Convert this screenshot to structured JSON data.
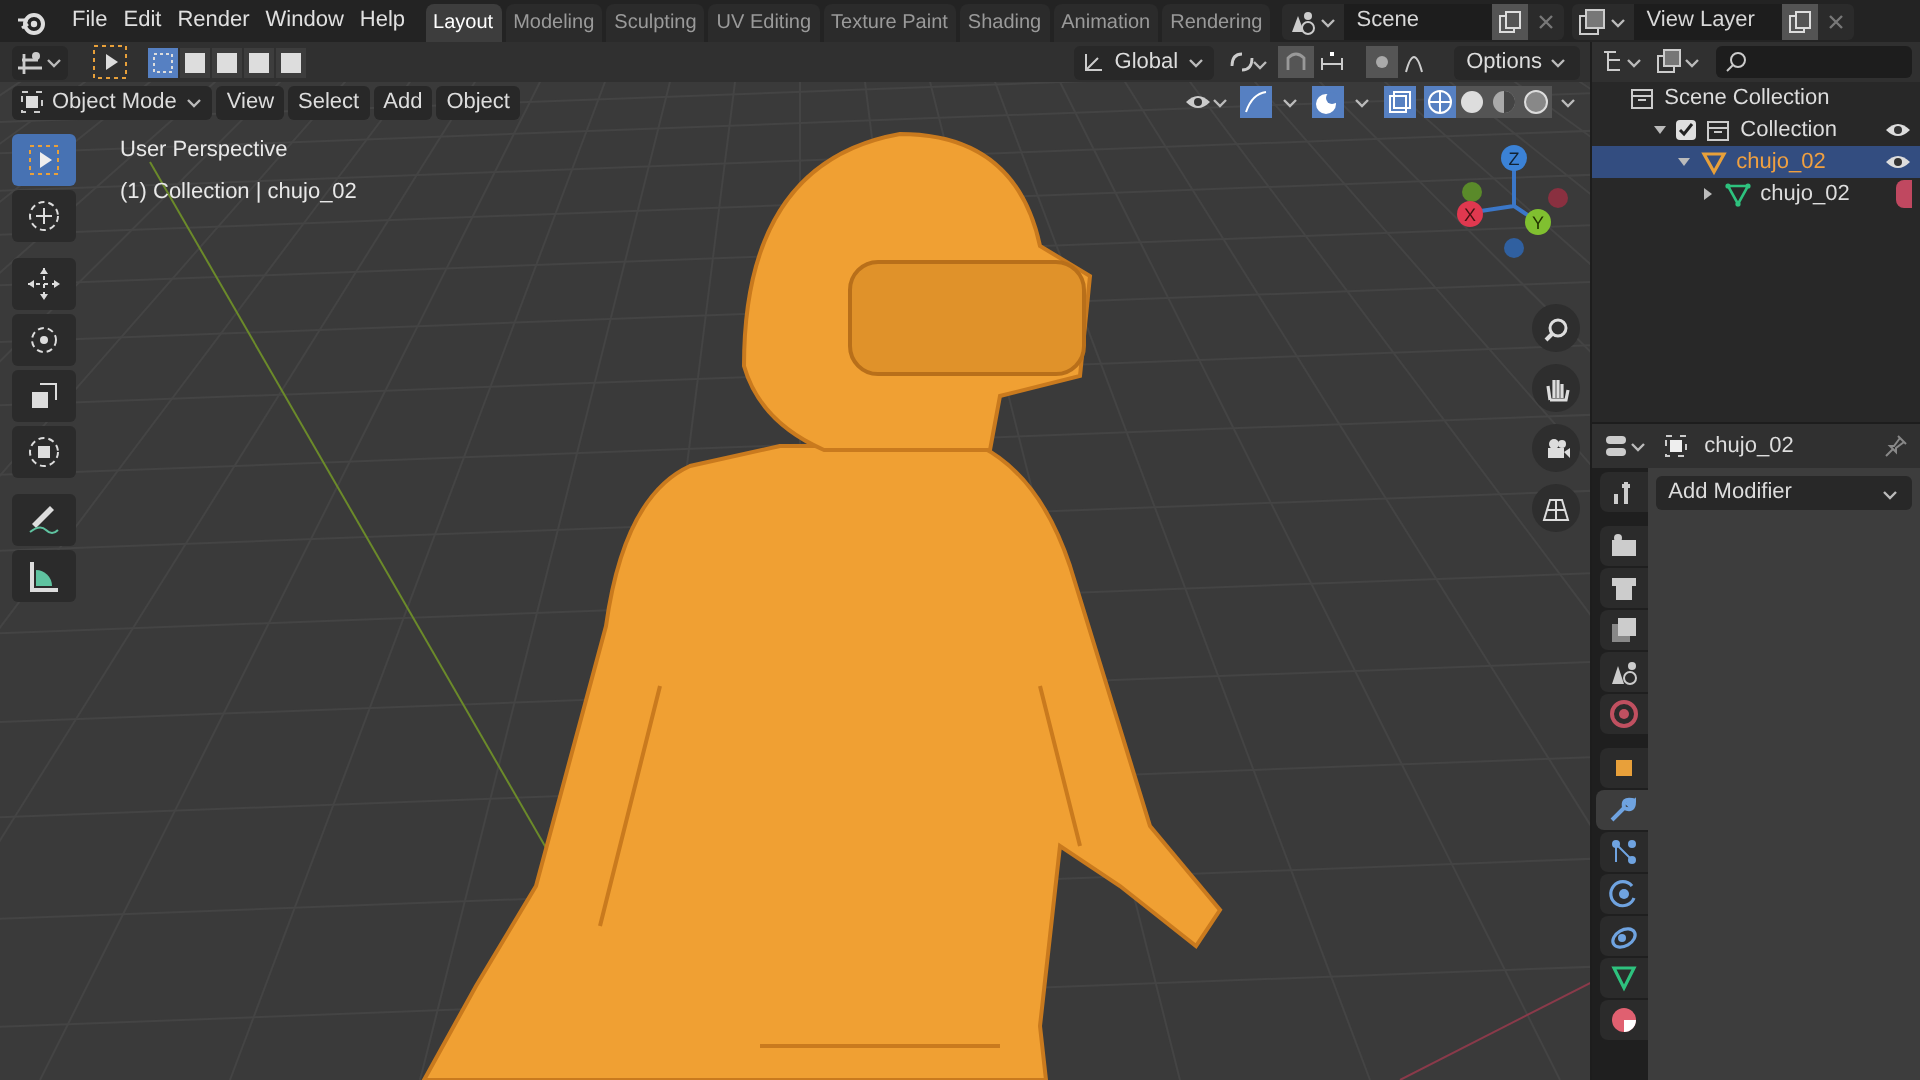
{
  "menu": [
    "File",
    "Edit",
    "Render",
    "Window",
    "Help"
  ],
  "workspace_tabs": [
    {
      "label": "Layout",
      "selected": true
    },
    {
      "label": "Modeling",
      "selected": false
    },
    {
      "label": "Sculpting",
      "selected": false
    },
    {
      "label": "UV Editing",
      "selected": false
    },
    {
      "label": "Texture Paint",
      "selected": false
    },
    {
      "label": "Shading",
      "selected": false
    },
    {
      "label": "Animation",
      "selected": false
    },
    {
      "label": "Rendering",
      "selected": false
    }
  ],
  "scene": "Scene",
  "view_layer": "View Layer",
  "tool_header": {
    "orientation": "Global",
    "options": "Options"
  },
  "view_header": {
    "mode": "Object Mode",
    "menus": [
      "View",
      "Select",
      "Add",
      "Object"
    ]
  },
  "tools": [
    {
      "kind": "select",
      "selected": true
    },
    {
      "kind": "cursor",
      "selected": false
    },
    {
      "kind": "move",
      "selected": false
    },
    {
      "kind": "rotate",
      "selected": false
    },
    {
      "kind": "scale",
      "selected": false
    },
    {
      "kind": "transform",
      "selected": false
    },
    {
      "kind": "annotate",
      "selected": false
    },
    {
      "kind": "measure",
      "selected": false
    }
  ],
  "viewport": {
    "info": [
      "User Perspective",
      "(1) Collection | chujo_02"
    ]
  },
  "gizmo": {
    "x": "X",
    "y": "Y",
    "z": "Z"
  },
  "outliner": [
    {
      "label": "Scene Collection",
      "kind": "scene",
      "selected": false,
      "children": [
        {
          "label": "Collection",
          "kind": "collection",
          "selected": false,
          "checked": true,
          "visible": true,
          "expanded": true,
          "children": [
            {
              "label": "chujo_02",
              "kind": "object",
              "selected": true,
              "visible": true,
              "expanded": true,
              "children": [
                {
                  "label": "chujo_02",
                  "kind": "mesh",
                  "selected": false,
                  "expanded": false
                }
              ]
            }
          ]
        }
      ]
    }
  ],
  "properties": {
    "object_name": "chujo_02",
    "add_modifier": "Add Modifier",
    "tabs": [
      {
        "kind": "tool",
        "selected": false
      },
      {
        "kind": "render",
        "selected": false
      },
      {
        "kind": "output",
        "selected": false
      },
      {
        "kind": "view_layer",
        "selected": false
      },
      {
        "kind": "scene",
        "selected": false
      },
      {
        "kind": "world",
        "selected": false
      },
      {
        "kind": "object",
        "selected": false
      },
      {
        "kind": "modifier",
        "selected": true
      },
      {
        "kind": "particles",
        "selected": false
      },
      {
        "kind": "physics",
        "selected": false
      },
      {
        "kind": "constraints",
        "selected": false
      },
      {
        "kind": "data",
        "selected": false
      },
      {
        "kind": "material",
        "selected": false
      }
    ]
  }
}
